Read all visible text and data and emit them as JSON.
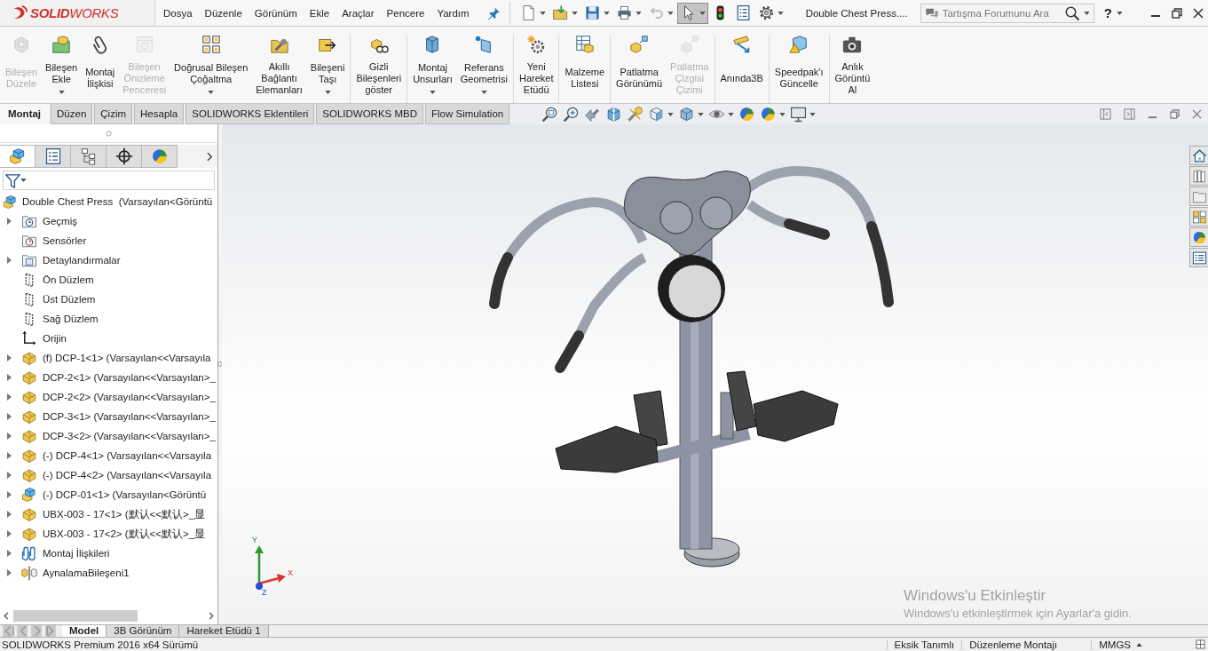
{
  "title_bar": {
    "logo": "**SOLID**WORKS",
    "menu": [
      "Dosya",
      "Düzenle",
      "Görünüm",
      "Ekle",
      "Araçlar",
      "Pencere",
      "Yardım"
    ],
    "toolbar": [
      {
        "kind": "new",
        "dropdown": true,
        "disabled": false,
        "selected": false
      },
      {
        "kind": "open",
        "dropdown": true,
        "disabled": false,
        "selected": false
      },
      {
        "kind": "save",
        "dropdown": true,
        "disabled": false,
        "selected": false
      },
      {
        "kind": "print",
        "dropdown": true,
        "disabled": false,
        "selected": false
      },
      {
        "kind": "undo",
        "dropdown": true,
        "disabled": true,
        "selected": false
      },
      {
        "kind": "select",
        "dropdown": true,
        "disabled": false,
        "selected": true
      },
      {
        "kind": "rebuild",
        "dropdown": false,
        "disabled": false,
        "selected": false
      },
      {
        "kind": "file-properties",
        "dropdown": false,
        "disabled": false,
        "selected": false
      },
      {
        "kind": "options",
        "dropdown": true,
        "disabled": false,
        "selected": false
      }
    ],
    "document_title": "Double Chest Press....",
    "search": {
      "placeholder": "Tartışma Forumunu Ara"
    },
    "help": "?"
  },
  "ribbon": {
    "groups": [
      {
        "buttons": [
          {
            "label": "Bileşen\nDüzele",
            "kind": "edit-component",
            "disabled": true,
            "dropdown": false
          },
          {
            "label": "Bileşen\nEkle",
            "kind": "insert-component",
            "disabled": false,
            "dropdown": true
          },
          {
            "label": "Montaj\nİlişkisi",
            "kind": "mate",
            "disabled": false,
            "dropdown": false
          },
          {
            "label": "Bileşen\nÖnizleme\nPenceresi",
            "kind": "preview",
            "disabled": true,
            "dropdown": false
          },
          {
            "label": "Doğrusal Bileşen\nÇoğaltma",
            "kind": "pattern",
            "disabled": false,
            "dropdown": true
          },
          {
            "label": "Akıllı\nBağlantı\nElemanları",
            "kind": "fasteners",
            "disabled": false,
            "dropdown": false
          },
          {
            "label": "Bileşeni\nTaşı",
            "kind": "move",
            "disabled": false,
            "dropdown": true
          }
        ]
      },
      {
        "buttons": [
          {
            "label": "Gizli\nBileşenleri\ngöster",
            "kind": "show-hidden",
            "disabled": false,
            "dropdown": false
          }
        ]
      },
      {
        "buttons": [
          {
            "label": "Montaj\nUnsurları",
            "kind": "assembly-features",
            "disabled": false,
            "dropdown": true
          },
          {
            "label": "Referans\nGeometrisi",
            "kind": "reference",
            "disabled": false,
            "dropdown": true
          }
        ]
      },
      {
        "buttons": [
          {
            "label": "Yeni\nHareket\nEtüdü",
            "kind": "motion",
            "disabled": false,
            "dropdown": false
          }
        ]
      },
      {
        "buttons": [
          {
            "label": "Malzeme\nListesi",
            "kind": "bom",
            "disabled": false,
            "dropdown": false
          }
        ]
      },
      {
        "buttons": [
          {
            "label": "Patlatma\nGörünümü",
            "kind": "explode",
            "disabled": false,
            "dropdown": false
          },
          {
            "label": "Patlatma\nÇizgisi\nÇizimi",
            "kind": "explode-line",
            "disabled": true,
            "dropdown": false
          }
        ]
      },
      {
        "buttons": [
          {
            "label": "Anında3B",
            "kind": "instant3d",
            "disabled": false,
            "dropdown": false
          }
        ]
      },
      {
        "buttons": [
          {
            "label": "Speedpak'ı\nGüncelle",
            "kind": "speedpak",
            "disabled": false,
            "dropdown": false
          }
        ]
      },
      {
        "buttons": [
          {
            "label": "Anlık\nGörüntü\nAl",
            "kind": "snapshot",
            "disabled": false,
            "dropdown": false
          }
        ]
      }
    ]
  },
  "command_tabs": [
    {
      "label": "Montaj",
      "selected": true
    },
    {
      "label": "Düzen",
      "selected": false
    },
    {
      "label": "Çizim",
      "selected": false
    },
    {
      "label": "Hesapla",
      "selected": false
    },
    {
      "label": "SOLIDWORKS Eklentileri",
      "selected": false
    },
    {
      "label": "SOLIDWORKS MBD",
      "selected": false
    },
    {
      "label": "Flow Simulation",
      "selected": false
    }
  ],
  "view_toolbar": [
    {
      "kind": "zoom-fit",
      "dropdown": false
    },
    {
      "kind": "zoom-area",
      "dropdown": false
    },
    {
      "kind": "previous-view",
      "dropdown": false
    },
    {
      "kind": "section-view",
      "dropdown": false
    },
    {
      "kind": "annotation-view",
      "dropdown": false
    },
    {
      "kind": "view-orientation",
      "dropdown": true
    },
    {
      "kind": "display-style",
      "dropdown": true
    },
    {
      "kind": "hide-show",
      "dropdown": true
    },
    {
      "kind": "edit-appearance",
      "dropdown": false
    },
    {
      "kind": "apply-scene",
      "dropdown": true
    },
    {
      "kind": "view-settings",
      "dropdown": true
    }
  ],
  "feature_manager": {
    "tabs": [
      {
        "kind": "feature-manager",
        "selected": true
      },
      {
        "kind": "property-manager",
        "selected": false
      },
      {
        "kind": "configuration-manager",
        "selected": false
      },
      {
        "kind": "dimxpert",
        "selected": false
      },
      {
        "kind": "display-manager",
        "selected": false
      }
    ],
    "tree": {
      "label": "Double Chest Press  (Varsayılan<Görüntü",
      "kind": "assembly",
      "children": [
        {
          "label": "Geçmiş",
          "kind": "history",
          "expandable": true
        },
        {
          "label": "Sensörler",
          "kind": "sensors",
          "expandable": false
        },
        {
          "label": "Detaylandırmalar",
          "kind": "annotations",
          "expandable": true
        },
        {
          "label": "Ön Düzlem",
          "kind": "plane",
          "expandable": false
        },
        {
          "label": "Üst Düzlem",
          "kind": "plane",
          "expandable": false
        },
        {
          "label": "Sağ Düzlem",
          "kind": "plane",
          "expandable": false
        },
        {
          "label": "Orijin",
          "kind": "origin",
          "expandable": false
        },
        {
          "label": "(f) DCP-1<1> (Varsayılan<<Varsayıla",
          "kind": "part",
          "expandable": true
        },
        {
          "label": "DCP-2<1> (Varsayılan<<Varsayılan>_",
          "kind": "part",
          "expandable": true
        },
        {
          "label": "DCP-2<2> (Varsayılan<<Varsayılan>_",
          "kind": "part",
          "expandable": true
        },
        {
          "label": "DCP-3<1> (Varsayılan<<Varsayılan>_",
          "kind": "part",
          "expandable": true
        },
        {
          "label": "DCP-3<2> (Varsayılan<<Varsayılan>_",
          "kind": "part",
          "expandable": true
        },
        {
          "label": "(-) DCP-4<1> (Varsayılan<<Varsayıla",
          "kind": "part",
          "expandable": true
        },
        {
          "label": "(-) DCP-4<2> (Varsayılan<<Varsayıla",
          "kind": "part",
          "expandable": true
        },
        {
          "label": "(-) DCP-01<1> (Varsayılan<Görüntü",
          "kind": "subassembly",
          "expandable": true
        },
        {
          "label": "UBX-003 - 17<1> (默认<<默认>_显",
          "kind": "part",
          "expandable": true
        },
        {
          "label": "UBX-003 - 17<2> (默认<<默认>_显",
          "kind": "part",
          "expandable": true
        },
        {
          "label": "Montaj İlişkileri",
          "kind": "mates",
          "expandable": true
        },
        {
          "label": "AynalamaBileşeni1",
          "kind": "mirror",
          "expandable": true
        }
      ]
    }
  },
  "graphics_area": {
    "triad": {
      "x": "X",
      "y": "Y",
      "z": "Z"
    },
    "notice": {
      "title": "Windows'u Etkinleştir",
      "message": "Windows'u etkinleştirmek için Ayarlar'a gidin."
    }
  },
  "task_pane": [
    {
      "kind": "home"
    },
    {
      "kind": "library"
    },
    {
      "kind": "file-explorer"
    },
    {
      "kind": "view-palette"
    },
    {
      "kind": "appearance"
    },
    {
      "kind": "custom-properties"
    }
  ],
  "bottom_tabs": [
    {
      "label": "Model",
      "selected": true
    },
    {
      "label": "3B Görünüm",
      "selected": false
    },
    {
      "label": "Hareket Etüdü 1",
      "selected": false
    }
  ],
  "status_bar": {
    "version": "SOLIDWORKS Premium 2016 x64 Sürümü",
    "items": [
      "Eksik Tanımlı",
      "Düzenleme Montajı",
      "MMGS"
    ]
  }
}
